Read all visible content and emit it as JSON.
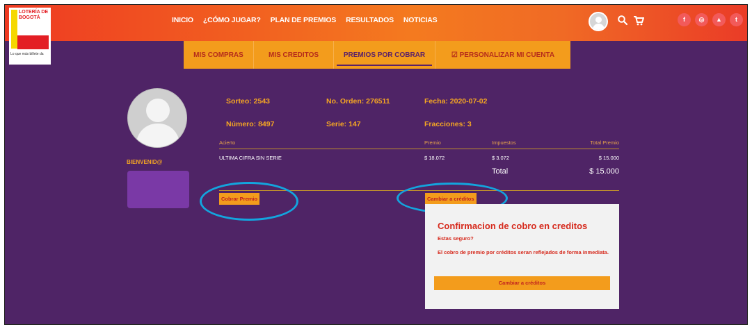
{
  "logo": {
    "text": "LOTERÍA DE BOGOTÁ",
    "slogan": "Lo que más billete da"
  },
  "nav": {
    "items": [
      "INICIO",
      "¿CÓMO JUGAR?",
      "PLAN DE PREMIOS",
      "RESULTADOS",
      "NOTICIAS"
    ]
  },
  "social": {
    "icons": [
      "facebook-icon",
      "instagram-icon",
      "youtube-icon",
      "twitter-icon"
    ],
    "glyphs": [
      "f",
      "◎",
      "▲",
      "t"
    ]
  },
  "tabs": {
    "items": [
      "MIS COMPRAS",
      "MIS CREDITOS",
      "PREMIOS POR COBRAR",
      "☑ PERSONALIZAR MI CUENTA"
    ],
    "active": "PREMIOS POR COBRAR"
  },
  "profile": {
    "welcome": "BIENVENID@"
  },
  "ticket": {
    "sorteo": "Sorteo: 2543",
    "orden": "No. Orden: 276511",
    "fecha": "Fecha: 2020-07-02",
    "numero": "Número: 8497",
    "serie": "Serie: 147",
    "fracciones": "Fracciones: 3"
  },
  "table": {
    "headers": [
      "Acierto",
      "Premio",
      "Impuestos",
      "Total Premio"
    ],
    "row": [
      "ULTIMA CIFRA SIN SERIE",
      "$ 18.072",
      "$ 3.072",
      "$ 15.000"
    ],
    "total_label": "Total",
    "total_value": "$ 15.000"
  },
  "actions": {
    "cobrar": "Cobrar Premio",
    "cambiar": "Cambiar a créditos"
  },
  "dialog": {
    "title": "Confirmacion de cobro en creditos",
    "question": "Estas seguro?",
    "message": "El cobro de premio por créditos seran reflejados de forma inmediata.",
    "button": "Cambiar a créditos"
  },
  "colors": {
    "purple": "#4f2466",
    "orange": "#f39c1c",
    "header_red": "#ee3a22",
    "highlight_blue": "#13a5de",
    "dialog_red": "#d62a1d"
  }
}
